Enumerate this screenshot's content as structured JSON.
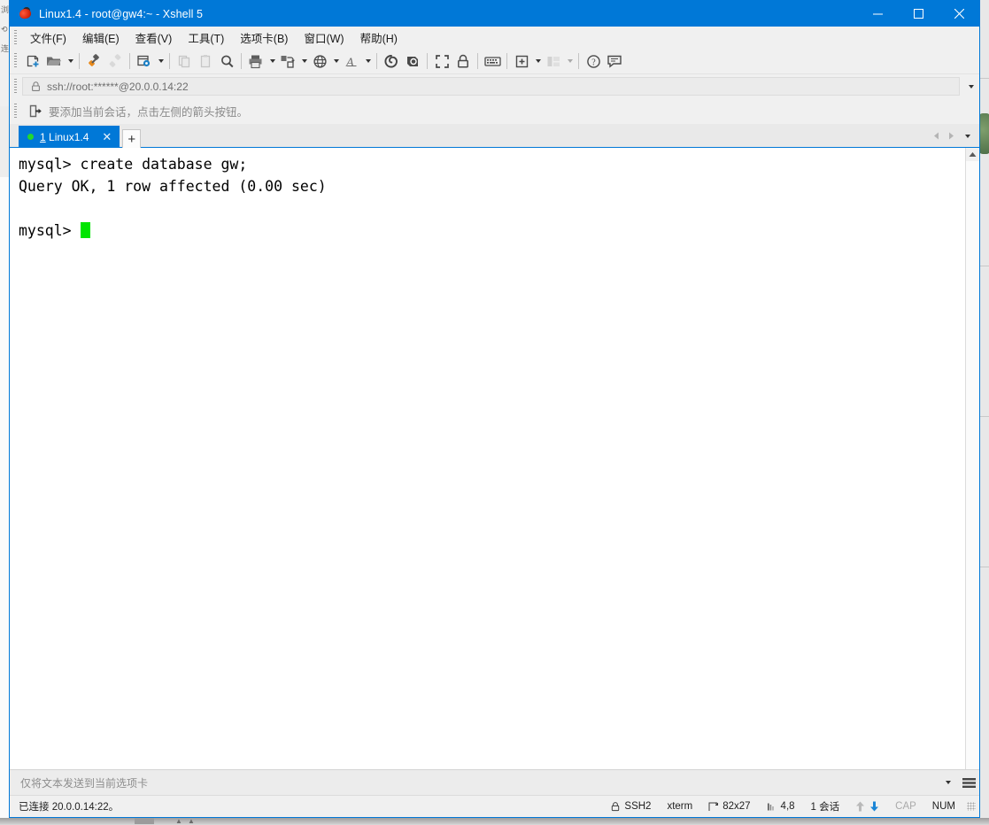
{
  "window": {
    "title": "Linux1.4 - root@gw4:~ - Xshell 5",
    "app_icon": "xshell-icon",
    "minimize": "—",
    "maximize": "▢",
    "close": "✕",
    "accent_color": "#0078d7"
  },
  "menubar": {
    "items": [
      {
        "label": "文件(F)",
        "name": "menu-file"
      },
      {
        "label": "编辑(E)",
        "name": "menu-edit"
      },
      {
        "label": "查看(V)",
        "name": "menu-view"
      },
      {
        "label": "工具(T)",
        "name": "menu-tools"
      },
      {
        "label": "选项卡(B)",
        "name": "menu-tabs"
      },
      {
        "label": "窗口(W)",
        "name": "menu-window"
      },
      {
        "label": "帮助(H)",
        "name": "menu-help"
      }
    ]
  },
  "toolbar": {
    "icons": [
      "new-session-icon",
      "open-folder-icon",
      "connect-icon",
      "disconnect-icon",
      "session-properties-icon",
      "copy-icon",
      "paste-icon",
      "find-icon",
      "print-icon",
      "transfer-icon",
      "globe-icon",
      "font-icon",
      "sftp-icon",
      "vnc-icon",
      "fullscreen-icon",
      "lock-icon",
      "keyboard-icon",
      "compose-icon",
      "layout-icon",
      "help-icon",
      "feedback-icon"
    ]
  },
  "address_bar": {
    "lock_icon": "lock-icon",
    "value": "ssh://root:******@20.0.0.14:22",
    "placeholder": "ssh://",
    "dropdown_icon": "chevron-down-icon"
  },
  "hint_bar": {
    "icon": "add-session-icon",
    "text": "要添加当前会话，点击左侧的箭头按钮。"
  },
  "tabs": {
    "items": [
      {
        "index": "1",
        "label": "Linux1.4",
        "status": "connected",
        "close_glyph": "✕"
      }
    ],
    "new_tab_glyph": "+",
    "scroll_left_glyph": "◀",
    "scroll_right_glyph": "▶",
    "list_glyph": "▾"
  },
  "terminal": {
    "lines": [
      "mysql> create database gw;",
      "Query OK, 1 row affected (0.00 sec)",
      "",
      "mysql> "
    ],
    "prompt_last": "mysql> ",
    "cursor_color": "#00e500",
    "background": "#ffffff",
    "foreground": "#000000",
    "scroll_up_glyph": "▲"
  },
  "send_bar": {
    "placeholder": "仅将文本发送到当前选项卡",
    "value": "",
    "dropdown_icon": "chevron-down-icon",
    "menu_icon": "hamburger-icon"
  },
  "status_bar": {
    "connection": "已连接 20.0.0.14:22。",
    "protocol": "SSH2",
    "protocol_icon": "lock-icon",
    "terminal_type": "xterm",
    "size": "82x27",
    "size_icon": "resize-icon",
    "cursor_position": "4,8",
    "cursor_icon": "cursor-icon",
    "sessions": "1 会话",
    "upload_icon": "arrow-up-icon",
    "download_icon": "arrow-down-icon",
    "cap_lock": "CAP",
    "num_lock": "NUM"
  }
}
